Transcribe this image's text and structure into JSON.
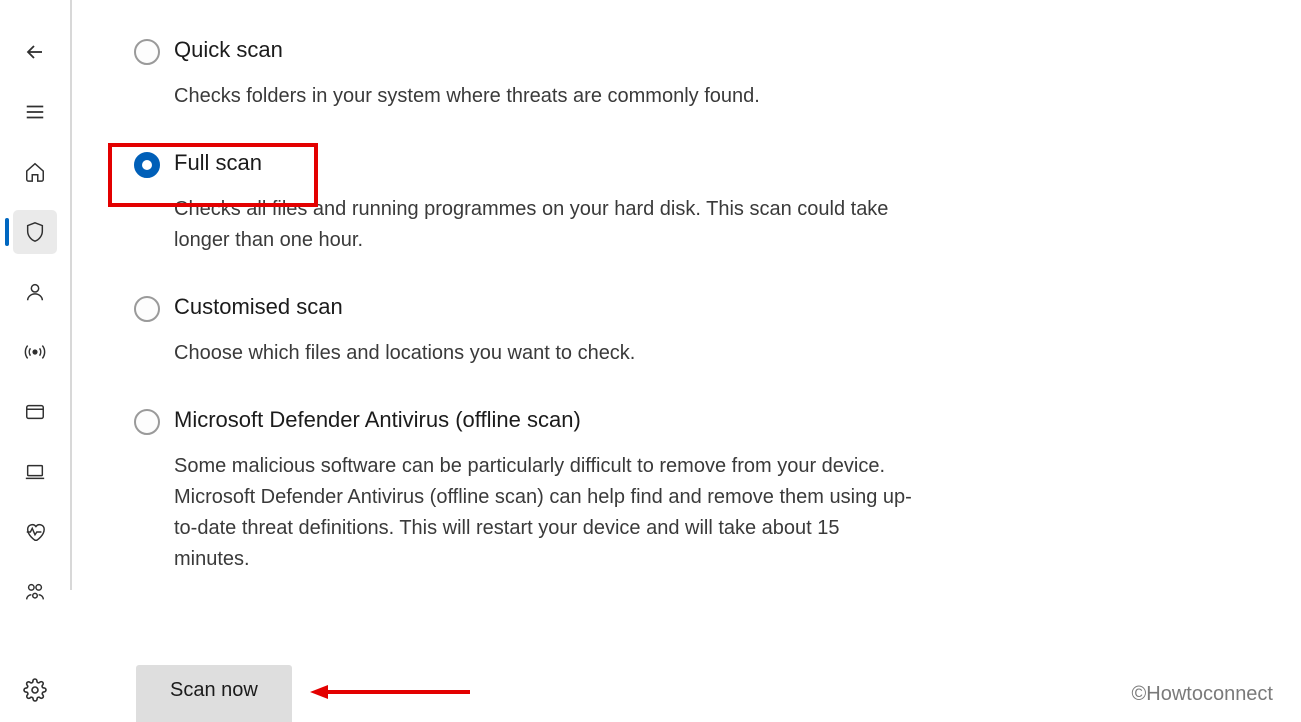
{
  "options": {
    "quick": {
      "title": "Quick scan",
      "desc": "Checks folders in your system where threats are commonly found."
    },
    "full": {
      "title": "Full scan",
      "desc": "Checks all files and running programmes on your hard disk. This scan could take longer than one hour."
    },
    "custom": {
      "title": "Customised scan",
      "desc": "Choose which files and locations you want to check."
    },
    "offline": {
      "title": "Microsoft Defender Antivirus (offline scan)",
      "desc": "Some malicious software can be particularly difficult to remove from your device. Microsoft Defender Antivirus (offline scan) can help find and remove them using up-to-date threat definitions. This will restart your device and will take about 15 minutes."
    }
  },
  "scan_button": "Scan now",
  "watermark": "©Howtoconnect"
}
